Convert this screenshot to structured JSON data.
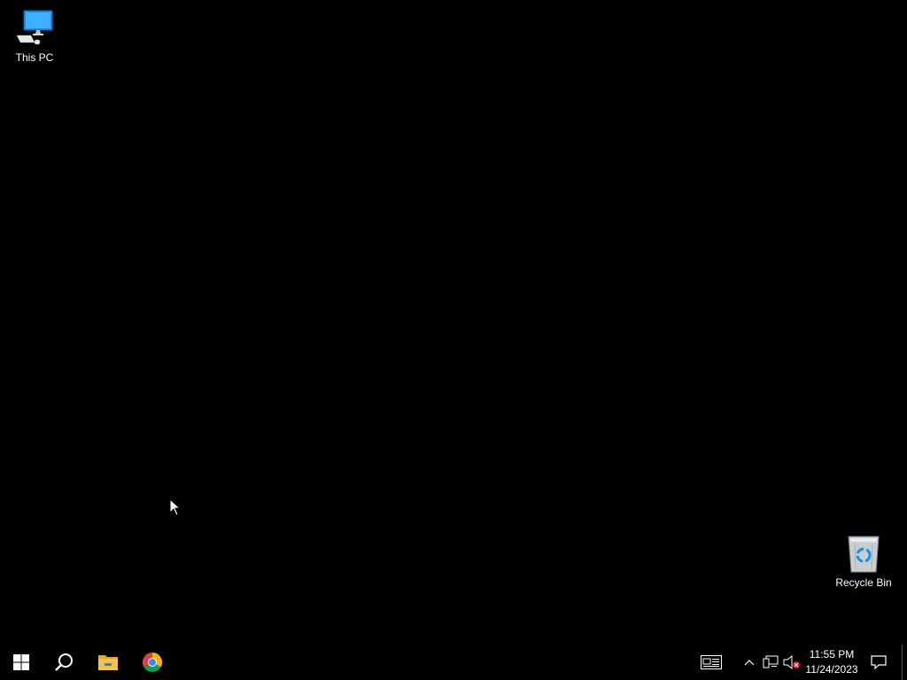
{
  "desktop": {
    "icons": [
      {
        "label": "This PC",
        "icon": "this-pc-icon"
      },
      {
        "label": "Recycle Bin",
        "icon": "recycle-bin-icon"
      }
    ]
  },
  "taskbar": {
    "pinned": [
      {
        "icon": "windows-start-icon"
      },
      {
        "icon": "search-icon"
      },
      {
        "icon": "file-explorer-icon"
      },
      {
        "icon": "chrome-icon"
      }
    ],
    "tray": {
      "icons": [
        "news-icon",
        "chevron-up-icon",
        "network-icon",
        "volume-muted-icon",
        "notification-icon"
      ],
      "time": "11:55 PM",
      "date": "11/24/2023"
    }
  },
  "colors": {
    "background": "#000000",
    "taskbar": "#000000",
    "windows_blue": "#0078d7",
    "folder_yellow": "#f2c44f",
    "chrome_red": "#db4437",
    "chrome_green": "#0f9d58",
    "chrome_yellow": "#f4b400",
    "chrome_blue": "#4285f4"
  }
}
